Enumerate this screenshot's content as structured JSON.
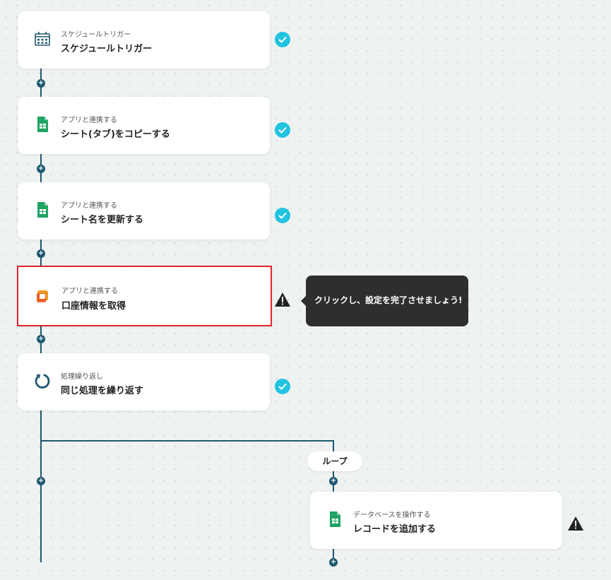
{
  "flow": {
    "steps": [
      {
        "category": "スケジュールトリガー",
        "title": "スケジュールトリガー",
        "icon": "calendar-icon",
        "status": "complete"
      },
      {
        "category": "アプリと連携する",
        "title": "シート(タブ)をコピーする",
        "icon": "google-sheets-icon",
        "status": "complete"
      },
      {
        "category": "アプリと連携する",
        "title": "シート名を更新する",
        "icon": "google-sheets-icon",
        "status": "complete"
      },
      {
        "category": "アプリと連携する",
        "title": "口座情報を取得",
        "icon": "app-orange-icon",
        "status": "warning"
      },
      {
        "category": "処理繰り返し",
        "title": "同じ処理を繰り返す",
        "icon": "loop-icon",
        "status": "complete"
      }
    ],
    "loop": {
      "label": "ループ",
      "step": {
        "category": "データベースを操作する",
        "title": "レコードを追加する",
        "icon": "google-sheets-icon",
        "status": "warning"
      }
    }
  },
  "tooltip": {
    "text": "クリックし、設定を完了させましょう!"
  },
  "colors": {
    "line": "#1e5870",
    "check": "#22c3e0",
    "selected_border": "#e0262b",
    "sheets_green": "#1fa463",
    "orange": "#f29a1f"
  }
}
